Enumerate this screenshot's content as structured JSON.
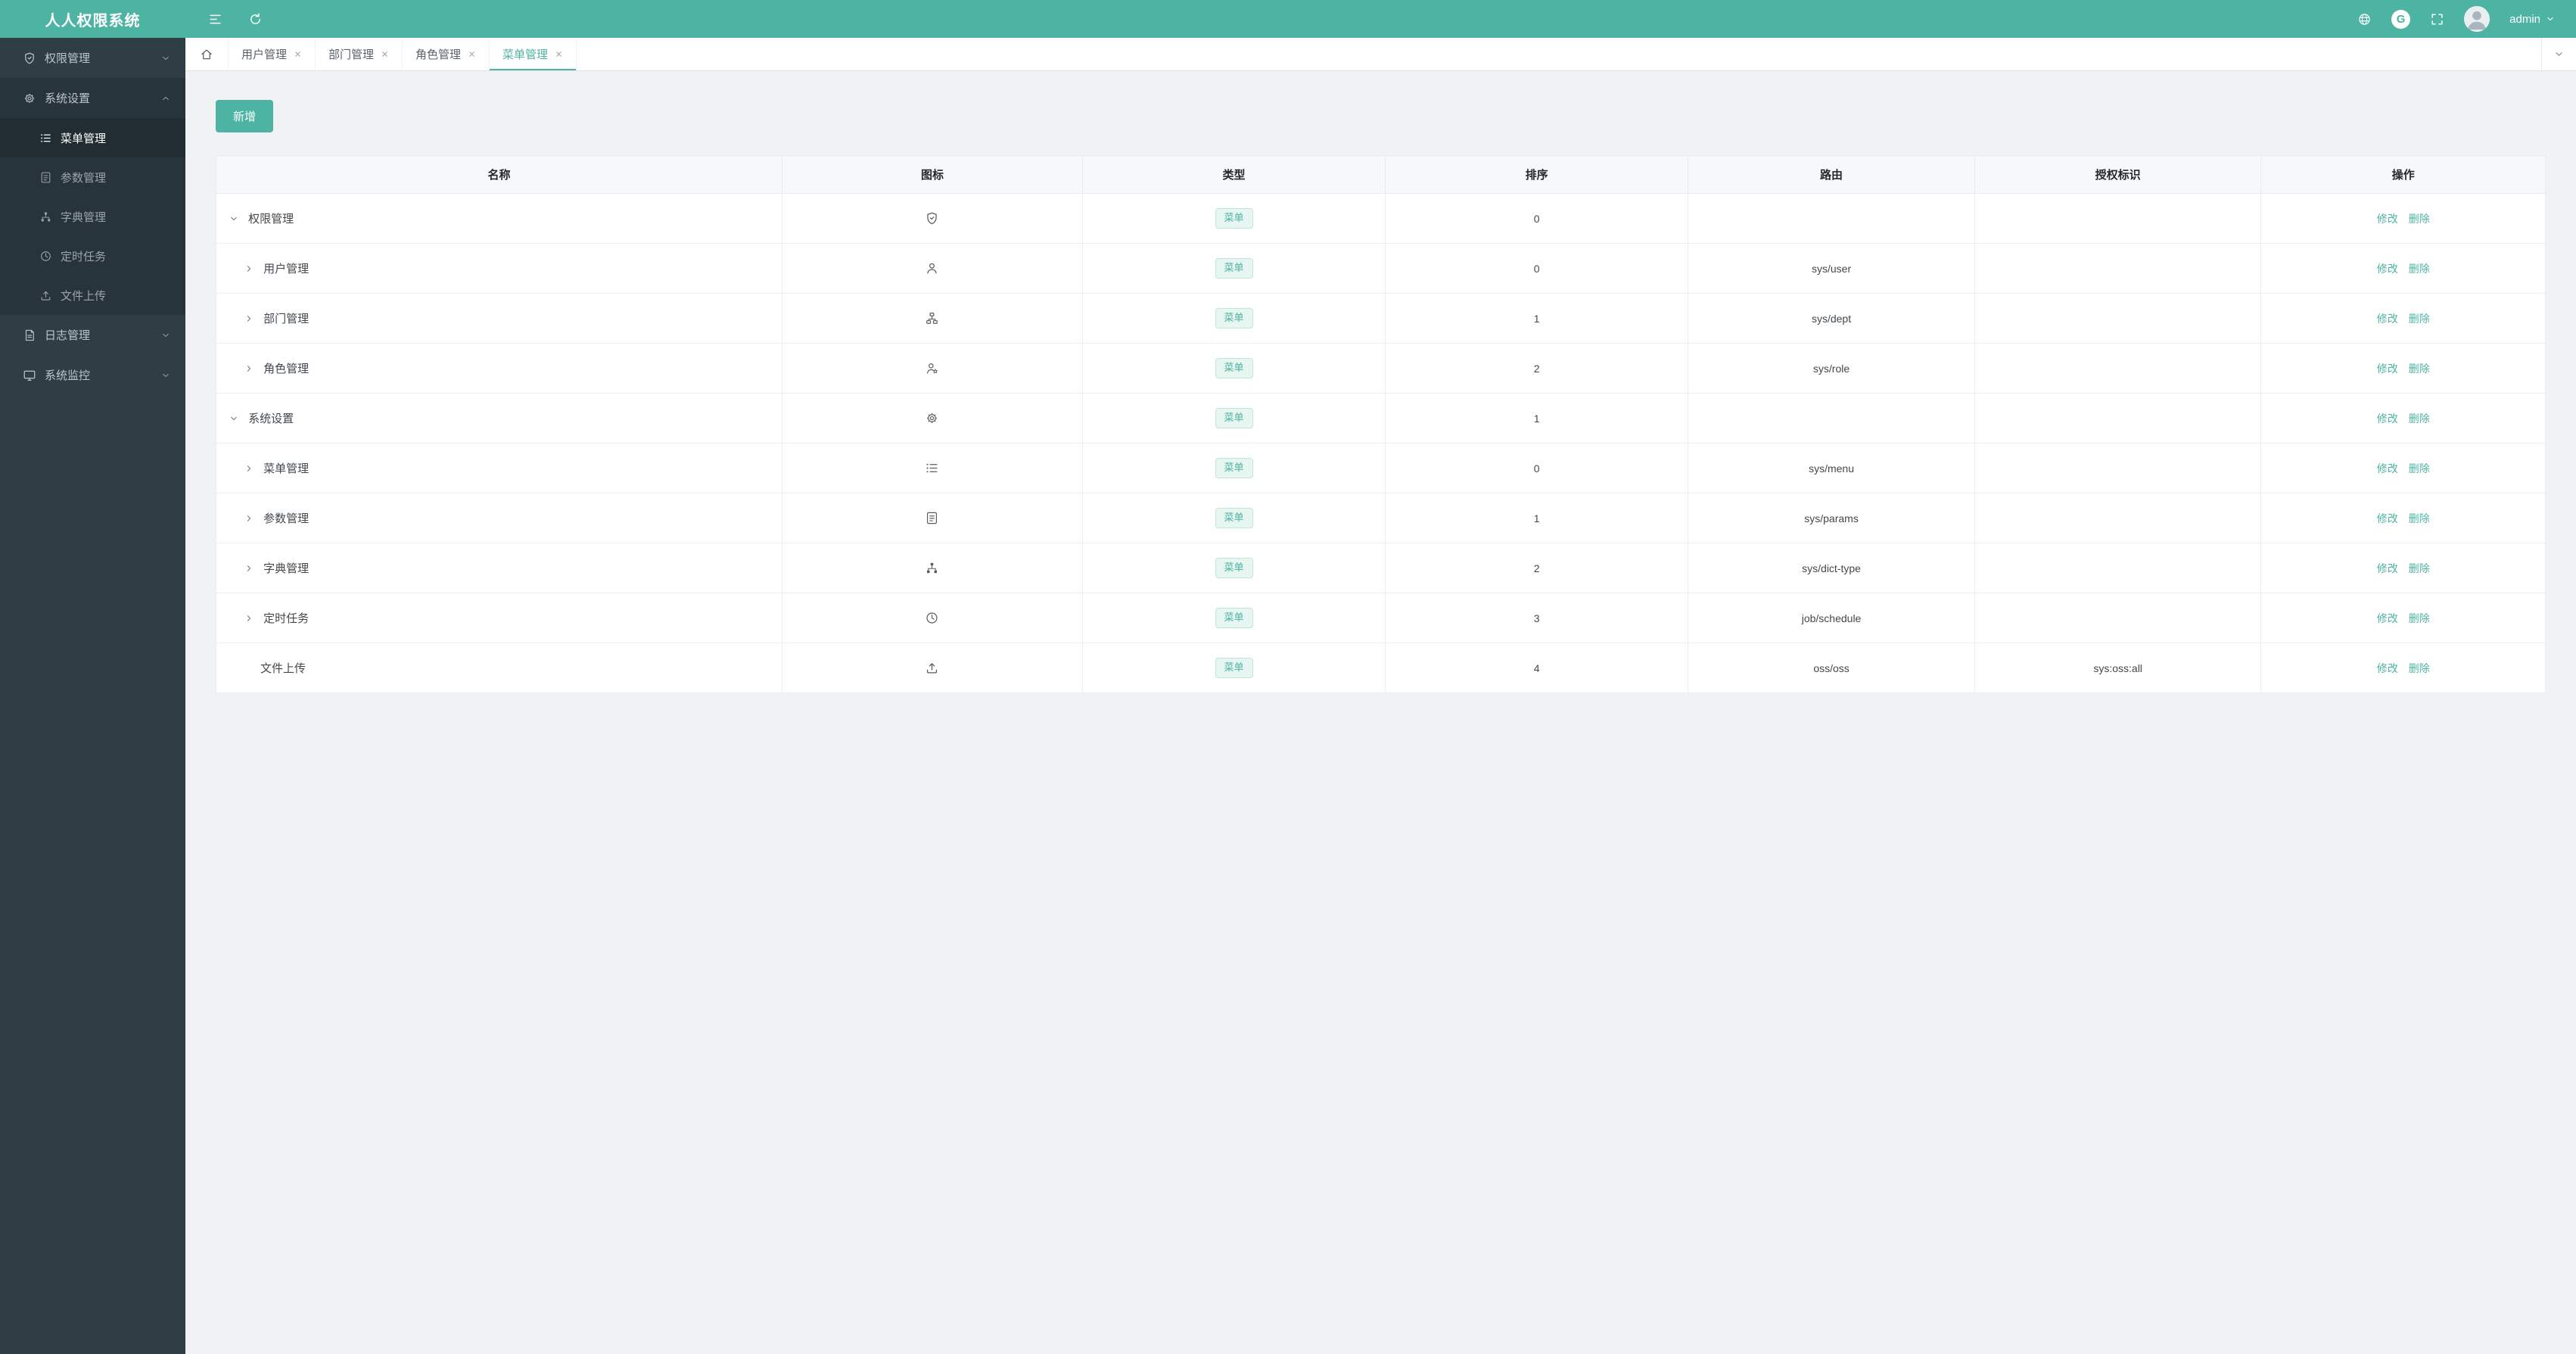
{
  "header": {
    "app_title": "人人权限系统",
    "username": "admin",
    "github_glyph": "G"
  },
  "sidebar": {
    "items": [
      {
        "label": "权限管理",
        "icon": "shield",
        "expanded": false
      },
      {
        "label": "系统设置",
        "icon": "gear",
        "expanded": true,
        "children": [
          {
            "label": "菜单管理",
            "icon": "list",
            "active": true
          },
          {
            "label": "参数管理",
            "icon": "document",
            "active": false
          },
          {
            "label": "字典管理",
            "icon": "dict-tree",
            "active": false
          },
          {
            "label": "定时任务",
            "icon": "clock",
            "active": false
          },
          {
            "label": "文件上传",
            "icon": "upload",
            "active": false
          }
        ]
      },
      {
        "label": "日志管理",
        "icon": "log",
        "expanded": false
      },
      {
        "label": "系统监控",
        "icon": "monitor",
        "expanded": false
      }
    ]
  },
  "tabs": {
    "items": [
      {
        "label": "用户管理",
        "active": false
      },
      {
        "label": "部门管理",
        "active": false
      },
      {
        "label": "角色管理",
        "active": false
      },
      {
        "label": "菜单管理",
        "active": true
      }
    ]
  },
  "toolbar": {
    "add_label": "新增"
  },
  "table": {
    "headers": [
      "名称",
      "图标",
      "类型",
      "排序",
      "路由",
      "授权标识",
      "操作"
    ],
    "edit_label": "修改",
    "delete_label": "删除",
    "rows": [
      {
        "name": "权限管理",
        "icon": "shield",
        "type": "菜单",
        "sort": "0",
        "route": "",
        "perm": "",
        "state": "expanded"
      },
      {
        "name": "用户管理",
        "icon": "user",
        "type": "菜单",
        "sort": "0",
        "route": "sys/user",
        "perm": "",
        "state": "collapsed"
      },
      {
        "name": "部门管理",
        "icon": "dept",
        "type": "菜单",
        "sort": "1",
        "route": "sys/dept",
        "perm": "",
        "state": "collapsed"
      },
      {
        "name": "角色管理",
        "icon": "role",
        "type": "菜单",
        "sort": "2",
        "route": "sys/role",
        "perm": "",
        "state": "collapsed"
      },
      {
        "name": "系统设置",
        "icon": "gear",
        "type": "菜单",
        "sort": "1",
        "route": "",
        "perm": "",
        "state": "expanded"
      },
      {
        "name": "菜单管理",
        "icon": "list",
        "type": "菜单",
        "sort": "0",
        "route": "sys/menu",
        "perm": "",
        "state": "collapsed"
      },
      {
        "name": "参数管理",
        "icon": "document",
        "type": "菜单",
        "sort": "1",
        "route": "sys/params",
        "perm": "",
        "state": "collapsed"
      },
      {
        "name": "字典管理",
        "icon": "dict-tree",
        "type": "菜单",
        "sort": "2",
        "route": "sys/dict-type",
        "perm": "",
        "state": "collapsed"
      },
      {
        "name": "定时任务",
        "icon": "clock",
        "type": "菜单",
        "sort": "3",
        "route": "job/schedule",
        "perm": "",
        "state": "collapsed"
      },
      {
        "name": "文件上传",
        "icon": "upload",
        "type": "菜单",
        "sort": "4",
        "route": "oss/oss",
        "perm": "sys:oss:all",
        "state": "leaf"
      }
    ]
  },
  "colors": {
    "accent": "#4db3a3",
    "sidebar_bg": "#2f3d45",
    "content_bg": "#f0f2f3",
    "tag_bg": "#e7f6f1"
  }
}
